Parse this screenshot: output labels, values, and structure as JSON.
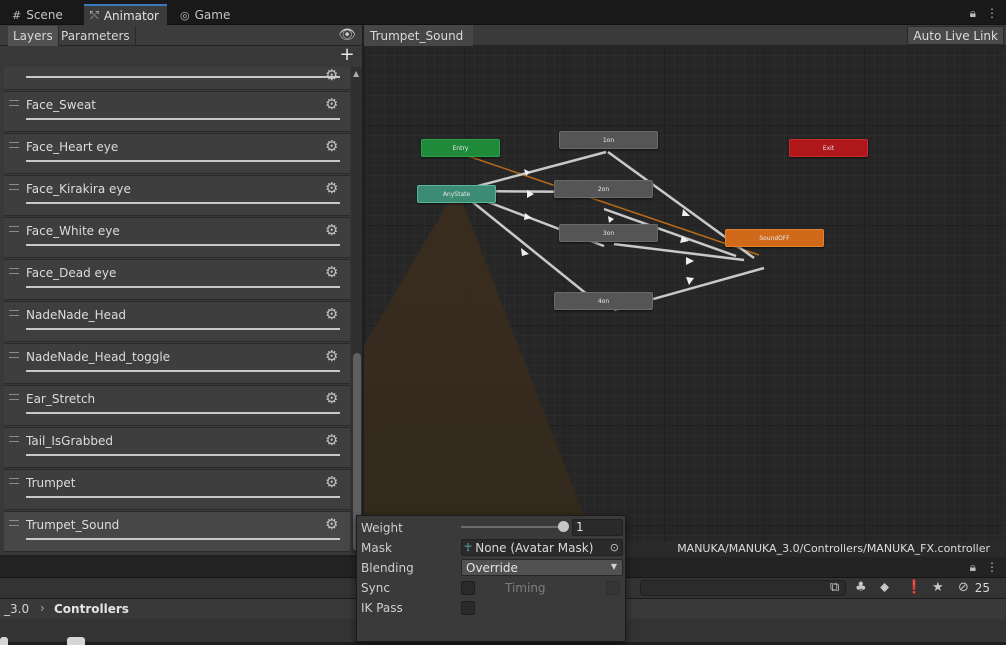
{
  "top_tabs": [
    {
      "label": "Scene",
      "icon": "grid-icon"
    },
    {
      "label": "Animator",
      "icon": "animator-icon"
    },
    {
      "label": "Game",
      "icon": "gamepad-icon"
    }
  ],
  "left_panel": {
    "tab_layers": "Layers",
    "tab_parameters": "Parameters",
    "layers": [
      {
        "name": "Face_Sweat"
      },
      {
        "name": "Face_Heart eye"
      },
      {
        "name": "Face_Kirakira eye"
      },
      {
        "name": "Face_White eye"
      },
      {
        "name": "Face_Dead eye"
      },
      {
        "name": "NadeNade_Head"
      },
      {
        "name": "NadeNade_Head_toggle"
      },
      {
        "name": "Ear_Stretch"
      },
      {
        "name": "Tail_IsGrabbed"
      },
      {
        "name": "Trumpet"
      },
      {
        "name": "Trumpet_Sound",
        "selected": true
      }
    ]
  },
  "graph": {
    "breadcrumb": "Trumpet_Sound",
    "auto_live_link": "Auto Live Link",
    "asset_path": "MANUKA/MANUKA_3.0/Controllers/MANUKA_FX.controller",
    "nodes": {
      "entry": "Entry",
      "exit": "Exit",
      "any_state": "AnyState",
      "s1": "1on",
      "s2": "2on",
      "s3": "3on",
      "s4": "4on",
      "default": "SoundOFF"
    },
    "colors": {
      "entry": "#1f8a3a",
      "exit": "#b0171b",
      "any_state": "#3b8c73",
      "default_state": "#d06a1a",
      "state": "#555555"
    }
  },
  "layer_settings": {
    "weight_label": "Weight",
    "weight_value": "1",
    "weight_fraction": 1.0,
    "mask_label": "Mask",
    "mask_value": "None (Avatar Mask)",
    "blending_label": "Blending",
    "blending_value": "Override",
    "sync_label": "Sync",
    "timing_label": "Timing",
    "ikpass_label": "IK Pass"
  },
  "project": {
    "breadcrumb_prev": "_3.0",
    "breadcrumb_current": "Controllers",
    "hidden_count": "25"
  }
}
